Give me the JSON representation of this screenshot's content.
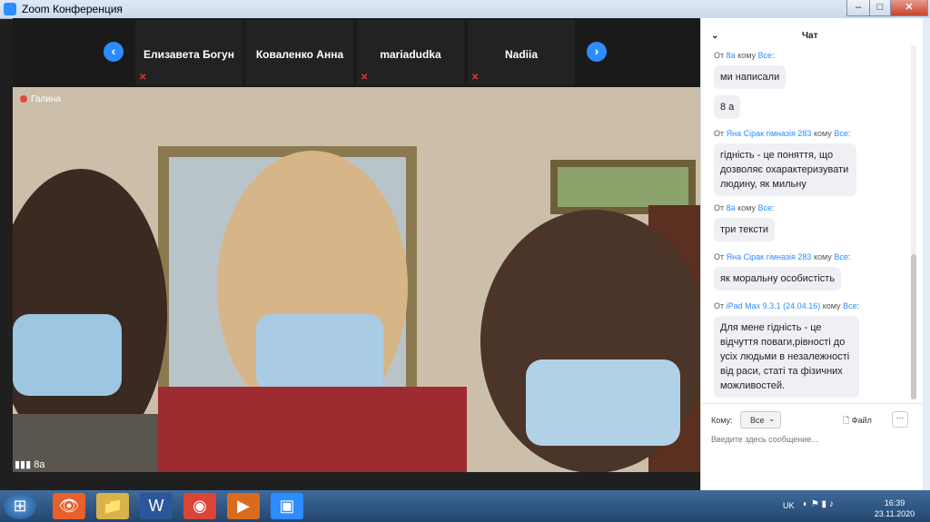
{
  "window": {
    "title": "Zoom Конференция",
    "min_label": "–",
    "max_label": "□",
    "close_label": "✕"
  },
  "participants": {
    "nav_prev": "‹",
    "nav_next": "›",
    "items": [
      {
        "name": "Елизавета Богун",
        "muted": true
      },
      {
        "name": "Коваленко Анна",
        "muted": false
      },
      {
        "name": "mariadudka",
        "muted": true
      },
      {
        "name": "Nadiia",
        "muted": true
      }
    ]
  },
  "main_video": {
    "speaker_tag": "Галина",
    "caption": "8а"
  },
  "chat": {
    "header_title": "Чат",
    "messages": [
      {
        "from": "8а",
        "to": "Все",
        "text": "ми написали"
      },
      {
        "from": "",
        "to": "",
        "text": "8 а"
      },
      {
        "from": "Яна Сірак гімназія 283",
        "to": "Все",
        "text": "гідність - це поняття, що дозволяє охарактеризувати людину, як мильну"
      },
      {
        "from": "8а",
        "to": "Все",
        "text": "три тексти"
      },
      {
        "from": "Яна Сірак гімназія 283",
        "to": "Все",
        "text": "як моральну особистість"
      },
      {
        "from": "iPad Max 9.3.1 (24.04.16)",
        "to": "Все",
        "text": "Для мене гідність - це відчуття поваги,рівності до усіх людьми в незалежності від раси, статі та фізичних можливостей."
      }
    ],
    "meta_from": "От",
    "meta_to": "кому",
    "recipient_label": "Кому:",
    "recipient_value": "Все",
    "file_label": "Файл",
    "more_label": "···",
    "input_placeholder": "Введите здесь сообщение..."
  },
  "taskbar": {
    "lang": "UK",
    "time": "16:39",
    "date": "23.11.2020"
  },
  "colors": {
    "accent": "#2d8cff",
    "mute_red": "#e33333"
  }
}
